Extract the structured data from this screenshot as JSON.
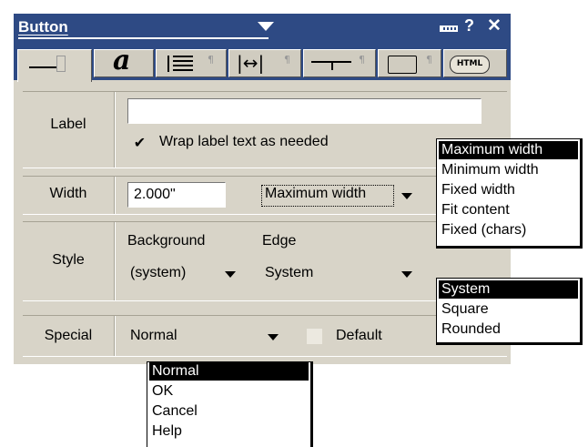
{
  "window": {
    "title": "Button"
  },
  "toolbar": {
    "tabs": [
      {
        "name": "appearance-tab",
        "glyph": "▁▁ ⁱ"
      },
      {
        "name": "font-tab",
        "glyph": "a"
      },
      {
        "name": "alignment-tab",
        "glyph": "|≡"
      },
      {
        "name": "spacing-tab",
        "glyph": "|↔|"
      },
      {
        "name": "border-tab",
        "glyph": "─┬─"
      },
      {
        "name": "script-tab",
        "glyph": "⌐⁀"
      },
      {
        "name": "html-tab",
        "glyph": "HTML"
      }
    ]
  },
  "label_row": {
    "label": "Label",
    "value": "",
    "wrap_checked": true,
    "wrap_check_glyph": "✔",
    "wrap_label": "Wrap label text as needed"
  },
  "width_row": {
    "label": "Width",
    "value": "2.000\"",
    "mode": "Maximum width"
  },
  "style_row": {
    "label": "Style",
    "background_label": "Background",
    "background_value": "(system)",
    "edge_label": "Edge",
    "edge_value": "System"
  },
  "special_row": {
    "label": "Special",
    "value": "Normal",
    "default_checked": false,
    "default_label": "Default"
  },
  "width_dropdown": {
    "items": [
      "Maximum width",
      "Minimum width",
      "Fixed width",
      "Fit content",
      "Fixed (chars)"
    ],
    "selected": 0
  },
  "edge_dropdown": {
    "items": [
      "System",
      "Square",
      "Rounded"
    ],
    "selected": 0
  },
  "special_dropdown": {
    "items": [
      "Normal",
      "OK",
      "Cancel",
      "Help"
    ],
    "selected": 0
  },
  "colors": {
    "titlebar": "#2e4a84",
    "panel": "#d8d4c8",
    "selection": "#000000"
  }
}
